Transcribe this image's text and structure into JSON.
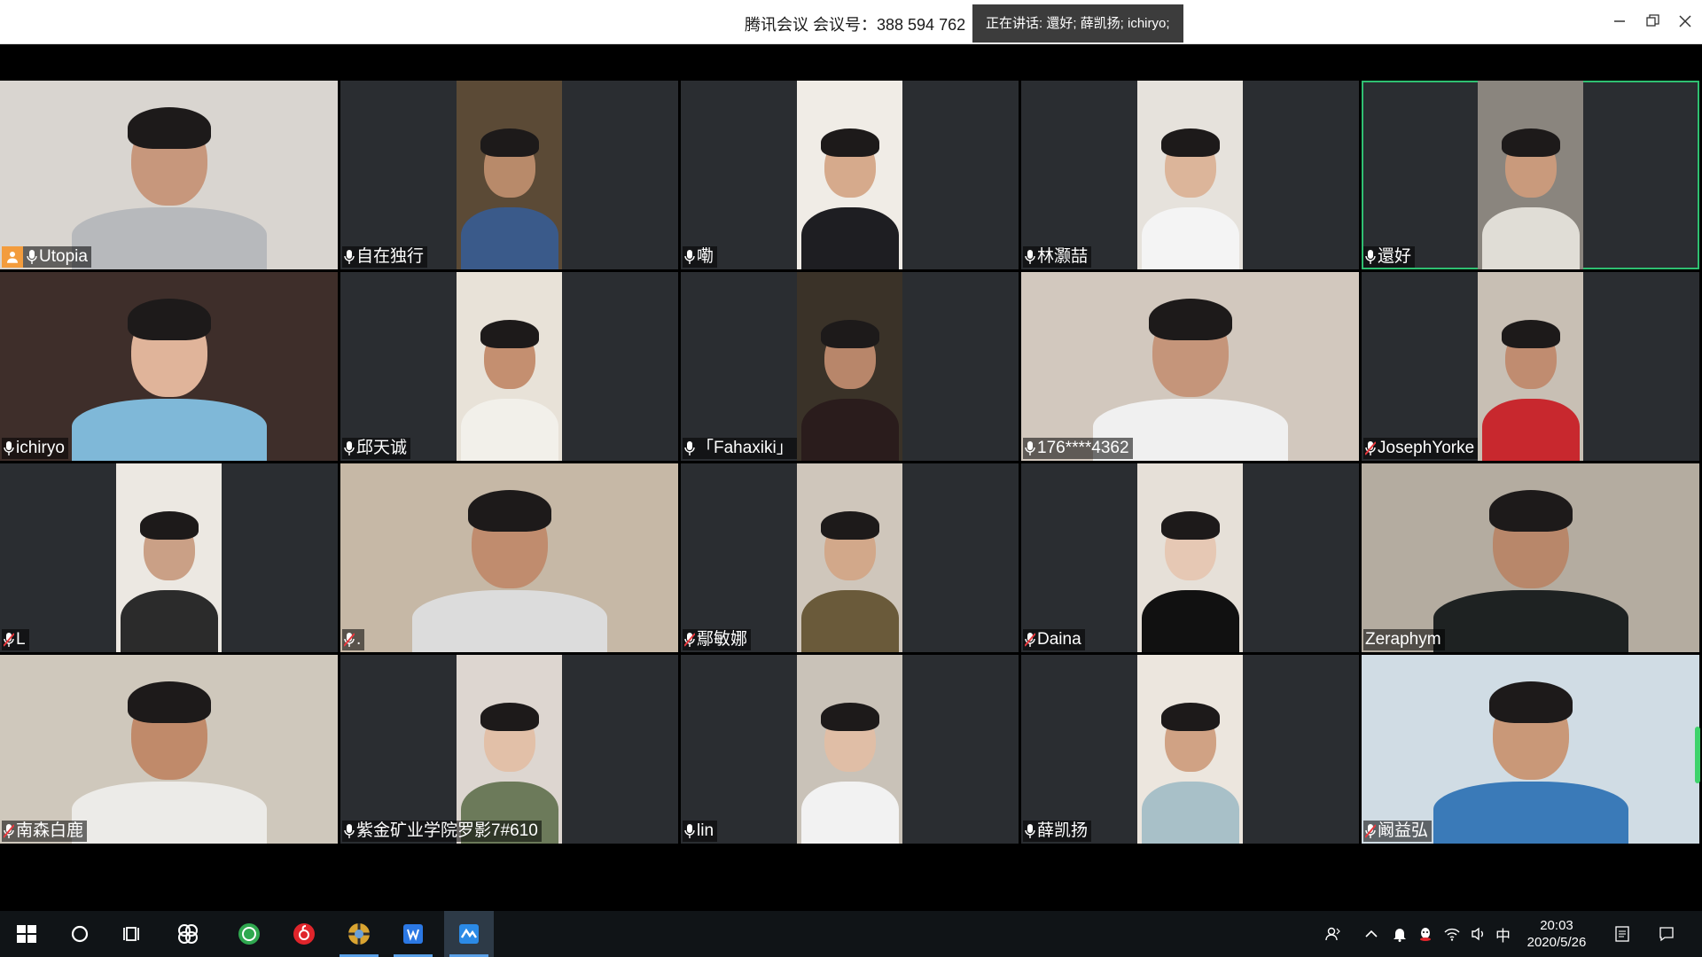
{
  "window": {
    "title": "腾讯会议 会议号：388 594 762",
    "speaking": "正在讲话: 還好; 薛凯扬; ichiryo;",
    "controls": [
      "minimize",
      "restore",
      "close"
    ]
  },
  "participants": [
    {
      "name": "Utopia",
      "mic": "on",
      "host": true,
      "bg": "#d9d5d0",
      "skin": "#c7977c",
      "shirt": "#b7b9bc",
      "video": "full"
    },
    {
      "name": "自在独行",
      "mic": "on",
      "bg": "#5b4a36",
      "skin": "#b88a6a",
      "shirt": "#3a5a8a",
      "video": "portrait"
    },
    {
      "name": "嘞",
      "mic": "on",
      "bg": "#f0ece6",
      "skin": "#d6aa8c",
      "shirt": "#1e1e22",
      "video": "portrait"
    },
    {
      "name": "林灏喆",
      "mic": "on",
      "bg": "#e6e2dc",
      "skin": "#dcb59a",
      "shirt": "#f4f4f4",
      "video": "portrait"
    },
    {
      "name": "還好",
      "mic": "on",
      "active": true,
      "bg": "#8a857e",
      "skin": "#c99a7c",
      "shirt": "#e0ddd6",
      "video": "portrait"
    },
    {
      "name": "ichiryo",
      "mic": "on",
      "bg": "#3e2e2a",
      "skin": "#e0b49a",
      "shirt": "#7fb8d8",
      "video": "full"
    },
    {
      "name": "邱天诚",
      "mic": "on",
      "bg": "#e8e2d8",
      "skin": "#c48f70",
      "shirt": "#f2f0ea",
      "video": "portrait"
    },
    {
      "name": "「Fahaxiki」",
      "mic": "on",
      "bg": "#3a3228",
      "skin": "#b8866a",
      "shirt": "#2a1c1c",
      "video": "portrait"
    },
    {
      "name": "176****4362",
      "mic": "on",
      "bg": "#d2c8be",
      "skin": "#c5957a",
      "shirt": "#f0f0f0",
      "video": "full"
    },
    {
      "name": "JosephYorke",
      "mic": "off",
      "bg": "#c8bfb4",
      "skin": "#c08c70",
      "shirt": "#c8282e",
      "video": "portrait"
    },
    {
      "name": "L",
      "mic": "off",
      "bg": "#ece8e2",
      "skin": "#caa086",
      "shirt": "#2b2b2b",
      "video": "portrait"
    },
    {
      "name": ".",
      "mic": "off",
      "bg": "#c6b8a6",
      "skin": "#c08c6e",
      "shirt": "#dcdcdc",
      "video": "full"
    },
    {
      "name": "鄢敏娜",
      "mic": "off",
      "bg": "#cfc6bb",
      "skin": "#d2a88a",
      "shirt": "#6a5a3a",
      "video": "portrait"
    },
    {
      "name": "Daina",
      "mic": "off",
      "bg": "#e6e0d8",
      "skin": "#e6c8b4",
      "shirt": "#111111",
      "video": "portrait"
    },
    {
      "name": "Zeraphym",
      "mic": "none",
      "bg": "#b4aca0",
      "skin": "#b8876a",
      "shirt": "#1e2222",
      "video": "full"
    },
    {
      "name": "南森白鹿",
      "mic": "off",
      "bg": "#cfc8bc",
      "skin": "#c08a6a",
      "shirt": "#ecebe8",
      "video": "full"
    },
    {
      "name": "紫金矿业学院罗影7#610",
      "mic": "on",
      "bg": "#ddd6d0",
      "skin": "#e2c0a8",
      "shirt": "#6c7a5a",
      "video": "portrait"
    },
    {
      "name": "lin",
      "mic": "on",
      "bg": "#c9c2b8",
      "skin": "#e0bea6",
      "shirt": "#f2f2f2",
      "video": "portrait"
    },
    {
      "name": "薛凯扬",
      "mic": "on",
      "bg": "#ece6de",
      "skin": "#d0a284",
      "shirt": "#a8c0c8",
      "video": "portrait"
    },
    {
      "name": "阚益弘",
      "mic": "off",
      "bg": "#d0dce4",
      "skin": "#c99878",
      "shirt": "#3a7ab8",
      "video": "full"
    }
  ],
  "taskbar": {
    "apps": [
      "windows-start",
      "search",
      "task-view",
      "app-pinwheel",
      "browser-360",
      "netease-music",
      "photo-app",
      "wps-writer",
      "tencent-meeting"
    ],
    "tray": [
      "people",
      "chevron-up",
      "notification-bell",
      "qq",
      "wifi",
      "volume"
    ],
    "ime": "中",
    "time": "20:03",
    "date": "2020/5/26"
  }
}
